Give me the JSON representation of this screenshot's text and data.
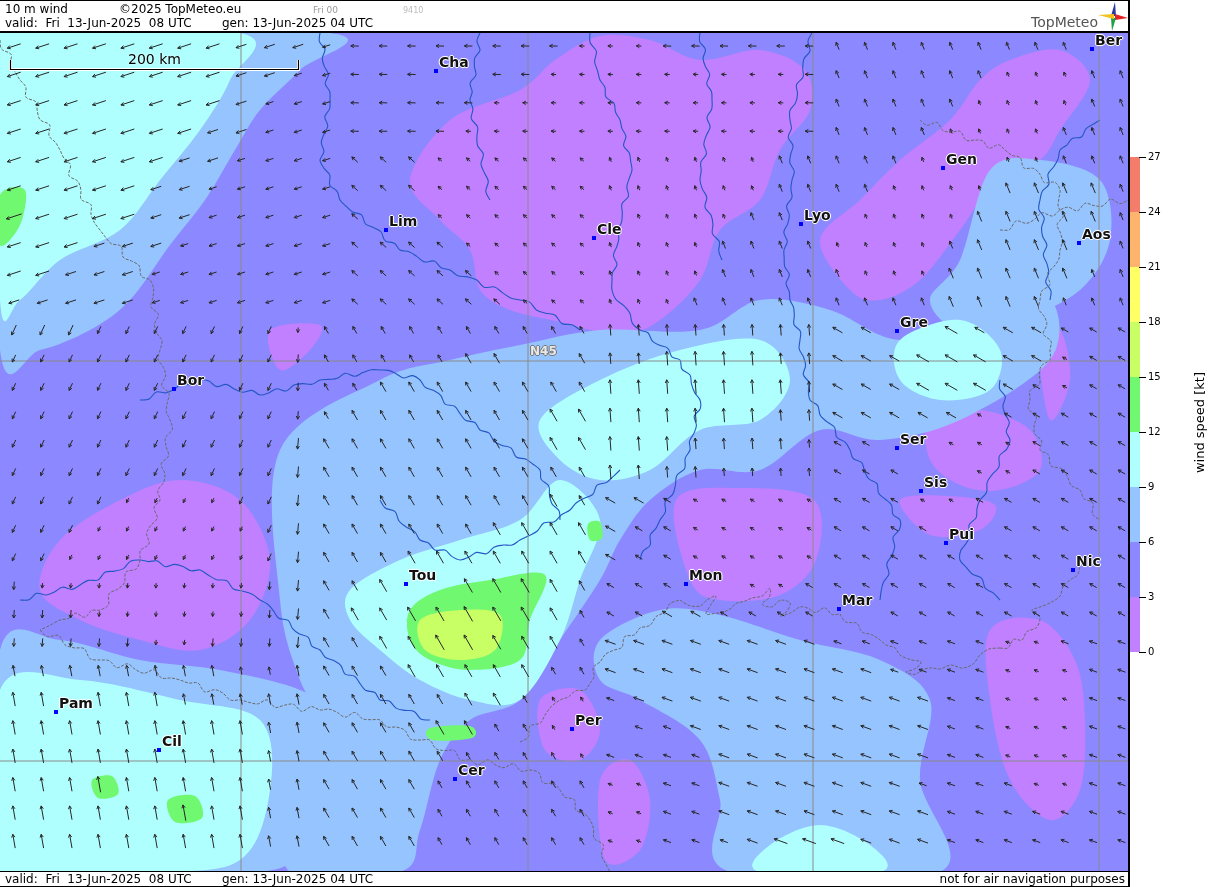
{
  "header": {
    "title": "10 m wind",
    "copyright": "©2025 TopMeteo.eu",
    "run_label": "Fri 00",
    "code": "9410",
    "valid": "valid:  Fri  13-Jun-2025  08 UTC",
    "generated": "gen: 13-Jun-2025 04 UTC"
  },
  "logo": {
    "text": "TopMeteo"
  },
  "map": {
    "scale_label": "200 km",
    "grid_label": "N45",
    "cities": [
      {
        "name": "Ber"
      },
      {
        "name": "Cha"
      },
      {
        "name": "Gen"
      },
      {
        "name": "Lyo"
      },
      {
        "name": "Lim"
      },
      {
        "name": "Cle"
      },
      {
        "name": "Aos"
      },
      {
        "name": "Gre"
      },
      {
        "name": "Bor"
      },
      {
        "name": "Ser"
      },
      {
        "name": "Sis"
      },
      {
        "name": "Pui"
      },
      {
        "name": "Nic"
      },
      {
        "name": "Tou"
      },
      {
        "name": "Mon"
      },
      {
        "name": "Mar"
      },
      {
        "name": "Pam"
      },
      {
        "name": "Per"
      },
      {
        "name": "Cil"
      },
      {
        "name": "Cer"
      }
    ]
  },
  "legend": {
    "title": "wind speed [kt]",
    "ticks": [
      "27",
      "24",
      "21",
      "18",
      "15",
      "12",
      "9",
      "6",
      "3",
      "0"
    ],
    "bands": [
      {
        "color": "#f47c6a"
      },
      {
        "color": "#ffb46e"
      },
      {
        "color": "#ffff66"
      },
      {
        "color": "#c8ff64"
      },
      {
        "color": "#70f870"
      },
      {
        "color": "#b0ffff"
      },
      {
        "color": "#96c4ff"
      },
      {
        "color": "#8c88ff"
      },
      {
        "color": "#c080ff"
      }
    ]
  },
  "footer": {
    "valid": "valid:  Fri  13-Jun-2025  08 UTC",
    "generated": "gen: 13-Jun-2025 04 UTC",
    "disclaimer": "not for air navigation purposes"
  }
}
